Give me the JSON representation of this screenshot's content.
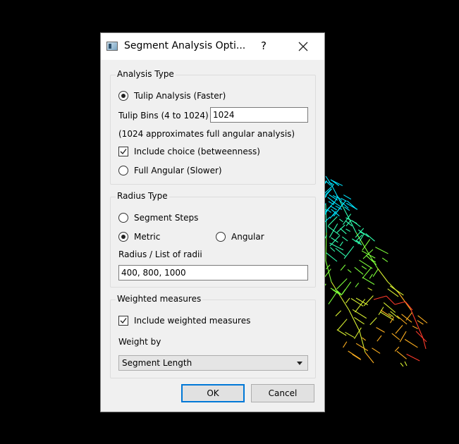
{
  "dialog": {
    "title": "Segment Analysis Opti...",
    "help_glyph": "?",
    "icons": {
      "app": "app-icon",
      "close": "close-icon"
    }
  },
  "analysis_type": {
    "legend": "Analysis Type",
    "tulip_label": "Tulip Analysis (Faster)",
    "tulip_selected": true,
    "bins_label": "Tulip Bins (4 to 1024)",
    "bins_value": "1024",
    "bins_note": "(1024 approximates full angular analysis)",
    "choice_label": "Include choice (betweenness)",
    "choice_checked": true,
    "full_label": "Full Angular (Slower)",
    "full_selected": false
  },
  "radius_type": {
    "legend": "Radius Type",
    "segment_steps_label": "Segment Steps",
    "metric_label": "Metric",
    "metric_selected": true,
    "angular_label": "Angular",
    "radii_label": "Radius / List of radii",
    "radii_value": "400, 800, 1000"
  },
  "weighted": {
    "legend": "Weighted measures",
    "include_label": "Include weighted measures",
    "include_checked": true,
    "weight_by_label": "Weight by",
    "weight_by_value": "Segment Length"
  },
  "buttons": {
    "ok": "OK",
    "cancel": "Cancel"
  },
  "map_colors": [
    "#00e5ff",
    "#30ffb0",
    "#7dff3a",
    "#d8f030",
    "#ffb020",
    "#ff3b2b"
  ]
}
